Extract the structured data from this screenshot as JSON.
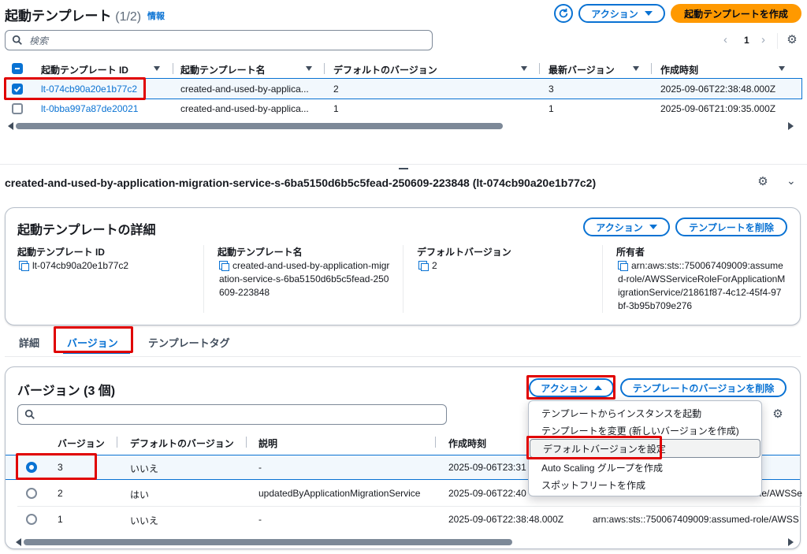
{
  "top": {
    "title": "起動テンプレート",
    "count": "(1/2)",
    "info": "情報",
    "actions_label": "アクション",
    "create_label": "起動テンプレートを作成",
    "search_placeholder": "検索",
    "page": "1",
    "columns": [
      "起動テンプレート ID",
      "起動テンプレート名",
      "デフォルトのバージョン",
      "最新バージョン",
      "作成時刻"
    ],
    "rows": [
      {
        "id": "lt-074cb90a20e1b77c2",
        "name": "created-and-used-by-applica...",
        "default": "2",
        "latest": "3",
        "created": "2025-09-06T22:38:48.000Z"
      },
      {
        "id": "lt-0bba997a87de20021",
        "name": "created-and-used-by-applica...",
        "default": "1",
        "latest": "1",
        "created": "2025-09-06T21:09:35.000Z"
      }
    ]
  },
  "detail": {
    "resource_title": "created-and-used-by-application-migration-service-s-6ba5150d6b5c5fead-250609-223848 (lt-074cb90a20e1b77c2)",
    "panel_title": "起動テンプレートの詳細",
    "actions_label": "アクション",
    "delete_label": "テンプレートを削除",
    "fields": [
      {
        "label": "起動テンプレート ID",
        "value": "lt-074cb90a20e1b77c2"
      },
      {
        "label": "起動テンプレート名",
        "value": "created-and-used-by-application-migration-service-s-6ba5150d6b5c5fead-250609-223848"
      },
      {
        "label": "デフォルトバージョン",
        "value": "2"
      },
      {
        "label": "所有者",
        "value": "arn:aws:sts::750067409009:assumed-role/AWSServiceRoleForApplicationMigrationService/21861f87-4c12-45f4-97bf-3b95b709e276"
      }
    ]
  },
  "tabs": [
    "詳細",
    "バージョン",
    "テンプレートタグ"
  ],
  "versions": {
    "title": "バージョン (3 個)",
    "actions_label": "アクション",
    "delete_label": "テンプレートのバージョンを削除",
    "columns": [
      "バージョン",
      "デフォルトのバージョン",
      "説明",
      "作成時刻"
    ],
    "rows": [
      {
        "version": "3",
        "default": "いいえ",
        "desc": "-",
        "created": "2025-09-06T23:31",
        "owner": ""
      },
      {
        "version": "2",
        "default": "はい",
        "desc": "updatedByApplicationMigrationService",
        "created": "2025-09-06T22:40",
        "owner": "-role/AWSSe"
      },
      {
        "version": "1",
        "default": "いいえ",
        "desc": "-",
        "created": "2025-09-06T22:38:48.000Z",
        "owner": "arn:aws:sts::750067409009:assumed-role/AWSSe"
      }
    ]
  },
  "menu": {
    "items": [
      "テンプレートからインスタンスを起動",
      "テンプレートを変更 (新しいバージョンを作成)",
      "デフォルトバージョンを設定",
      "Auto Scaling グループを作成",
      "スポットフリートを作成"
    ]
  }
}
